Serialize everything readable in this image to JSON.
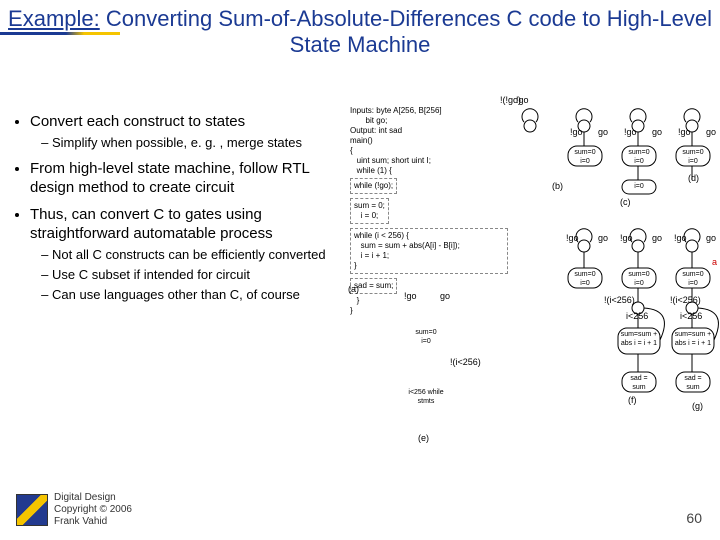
{
  "title_prefix": "Example:",
  "title_rest": " Converting Sum-of-Absolute-Differences C code to High-Level State Machine",
  "bullets": {
    "b1": "Convert each construct to states",
    "b1a": "Simplify when possible, e. g. , merge states",
    "b2": "From high-level state machine, follow RTL design method to create circuit",
    "b3": "Thus, can convert C to gates using straightforward automatable process",
    "b3a": "Not all C constructs can be efficiently converted",
    "b3b": "Use C subset if intended for circuit",
    "b3c": "Can use languages other than C, of course"
  },
  "code": {
    "l1": "Inputs: byte A[256, B[256]",
    "l2": "       bit go;",
    "l3": "Output: int sad",
    "l4": "main()",
    "l5": "{",
    "l6": "   uint sum; short uint I;",
    "l7": "   while (1) {",
    "l8": "while (!go);",
    "l9": "sum = 0;\n   i = 0;",
    "l10": "while (i < 256) {\n   sum = sum + abs(A[i] - B[i]);\n   i = i + 1;\n}",
    "l11": "sad = sum;",
    "l12": "   }",
    "l13": "}",
    "lbl_a": "(a)"
  },
  "dia": {
    "notgo_paren": "!(!go)",
    "notgo": "!go",
    "go": "go",
    "sum0": "sum=0\ni=0",
    "i0": "i=0",
    "b": "(b)",
    "c": "(c)",
    "d": "(d)",
    "e": "(e)",
    "f": "(f)",
    "g": "(g)",
    "ilt": "!(i<256)",
    "ilt2": "i<256",
    "while_stmts": "i<256\nwhile stmts",
    "sumabs": "sum=sum\n+ abs\ni = i + 1",
    "sadsum": "sad =\nsum",
    "a_red": "a"
  },
  "footer": {
    "l1": "Digital Design",
    "l2": "Copyright © 2006",
    "l3": "Frank Vahid"
  },
  "page": "60"
}
